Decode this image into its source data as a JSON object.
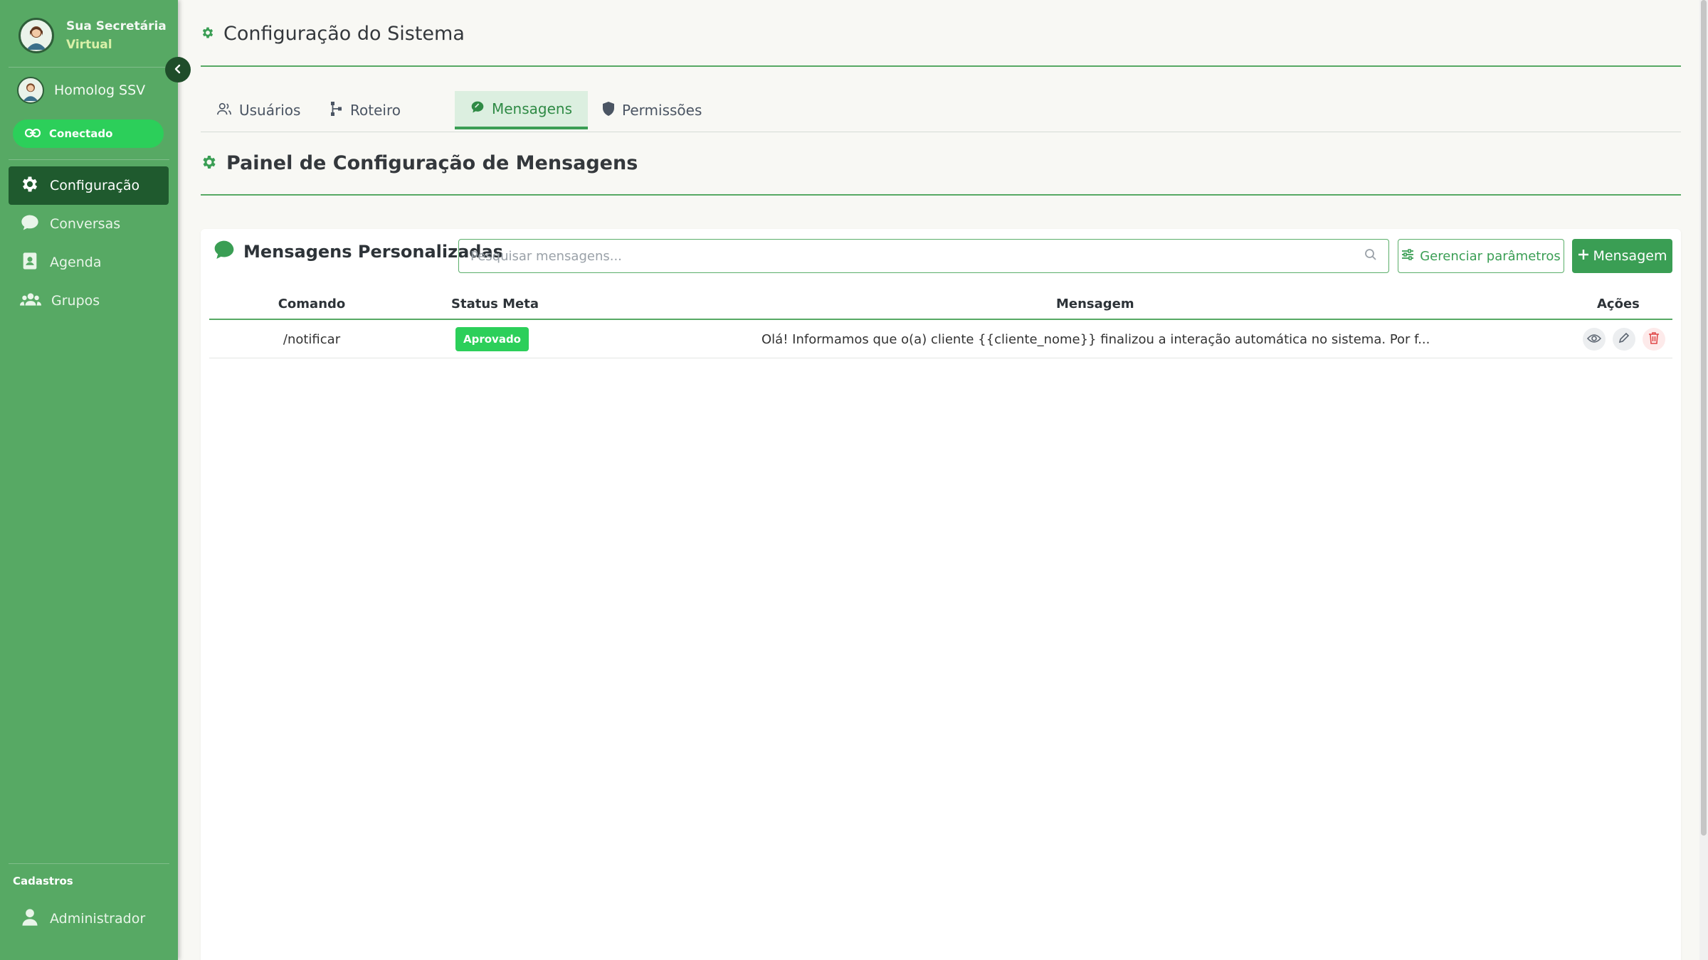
{
  "sidebar": {
    "brand_line1": "Sua Secretária",
    "brand_line2": "Virtual",
    "user_name": "Homolog SSV",
    "connection_status": "Conectado",
    "nav": [
      {
        "label": "Configuração",
        "icon": "gear-icon",
        "active": true
      },
      {
        "label": "Conversas",
        "icon": "chat-bubble-icon",
        "active": false
      },
      {
        "label": "Agenda",
        "icon": "contact-book-icon",
        "active": false
      },
      {
        "label": "Grupos",
        "icon": "users-group-icon",
        "active": false
      }
    ],
    "section_label": "Cadastros",
    "admin_label": "Administrador"
  },
  "main": {
    "page_title": "Configuração do Sistema",
    "tabs": [
      {
        "label": "Usuários",
        "icon": "users-icon",
        "active": false
      },
      {
        "label": "Roteiro",
        "icon": "flow-icon",
        "active": false
      },
      {
        "label": "Mensagens",
        "icon": "message-icon",
        "active": true
      },
      {
        "label": "Permissões",
        "icon": "shield-icon",
        "active": false
      }
    ],
    "panel_title": "Painel de Configuração de Mensagens",
    "card": {
      "title": "Mensagens Personalizadas",
      "search_placeholder": "Pesquisar mensagens...",
      "manage_params_label": "Gerenciar parâmetros",
      "new_message_label": "Mensagem"
    },
    "table": {
      "headers": {
        "command": "Comando",
        "status": "Status Meta",
        "message": "Mensagem",
        "actions": "Ações"
      },
      "rows": [
        {
          "command": "/notificar",
          "status": "Aprovado",
          "message": "Olá! Informamos que o(a) cliente {{cliente_nome}} finalizou a interação automática no sistema. Por f..."
        }
      ]
    }
  },
  "colors": {
    "sidebar_bg": "#57a964",
    "active_nav": "#1f5a2e",
    "accent": "#3a9e54",
    "badge_green": "#2ccf5a",
    "danger": "#e04848"
  }
}
